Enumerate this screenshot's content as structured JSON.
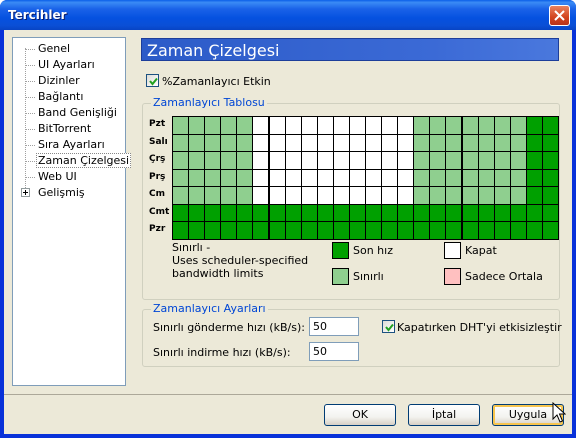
{
  "window": {
    "title": "Tercihler"
  },
  "tree": {
    "items": [
      {
        "label": "Genel"
      },
      {
        "label": "UI Ayarları"
      },
      {
        "label": "Dizinler"
      },
      {
        "label": "Bağlantı"
      },
      {
        "label": "Band Genişliği"
      },
      {
        "label": "BitTorrent"
      },
      {
        "label": "Sıra Ayarları"
      },
      {
        "label": "Zaman Çizelgesi",
        "selected": true
      },
      {
        "label": "Web UI"
      },
      {
        "label": "Gelişmiş",
        "expandable": true
      }
    ]
  },
  "page": {
    "title": "Zaman Çizelgesi",
    "enable_label": "%Zamanlayıcı Etkin",
    "enable_checked": true
  },
  "scheduler_table": {
    "group_title": "Zamanlayıcı Tablosu",
    "days": [
      "Pzt",
      "Salı",
      "Çrş",
      "Prş",
      "Cm",
      "Cmt",
      "Pzr"
    ],
    "rows": [
      "LLLLLWWWWWWWWWWLLLLLLLFFFF",
      "LLLLLWWWWWWWWWWLLLLLLLFFFF",
      "LLLLLWWWWWWWWWWLLLLLLLFFFF",
      "LLLLLWWWWWWWWWWLLLLLLLFFFF",
      "LLLLLWWWWWWWWWWLLLLLLLFFFF",
      "FFFFFFFFFFFFFFFFFFFFFFFFFF",
      "FFFFFFFFFFFFFFFFFFFFFFFFFF"
    ],
    "description": "Sınırlı - Uses scheduler-specified bandwidth limits",
    "legend": [
      {
        "label": "Son hız",
        "color": "#00a000"
      },
      {
        "label": "Kapat",
        "color": "#ffffff"
      },
      {
        "label": "Sınırlı",
        "color": "#8fcf8f"
      },
      {
        "label": "Sadece Ortala",
        "color": "#ffc0c0"
      }
    ]
  },
  "scheduler_settings": {
    "group_title": "Zamanlayıcı Ayarları",
    "upload_label": "Sınırlı gönderme hızı (kB/s):",
    "upload_value": "50",
    "download_label": "Sınırlı indirme hızı (kB/s):",
    "download_value": "50",
    "dht_label": "Kapatırken DHT'yi etkisizleştir",
    "dht_checked": true
  },
  "buttons": {
    "ok": "OK",
    "cancel": "İptal",
    "apply": "Uygula"
  }
}
